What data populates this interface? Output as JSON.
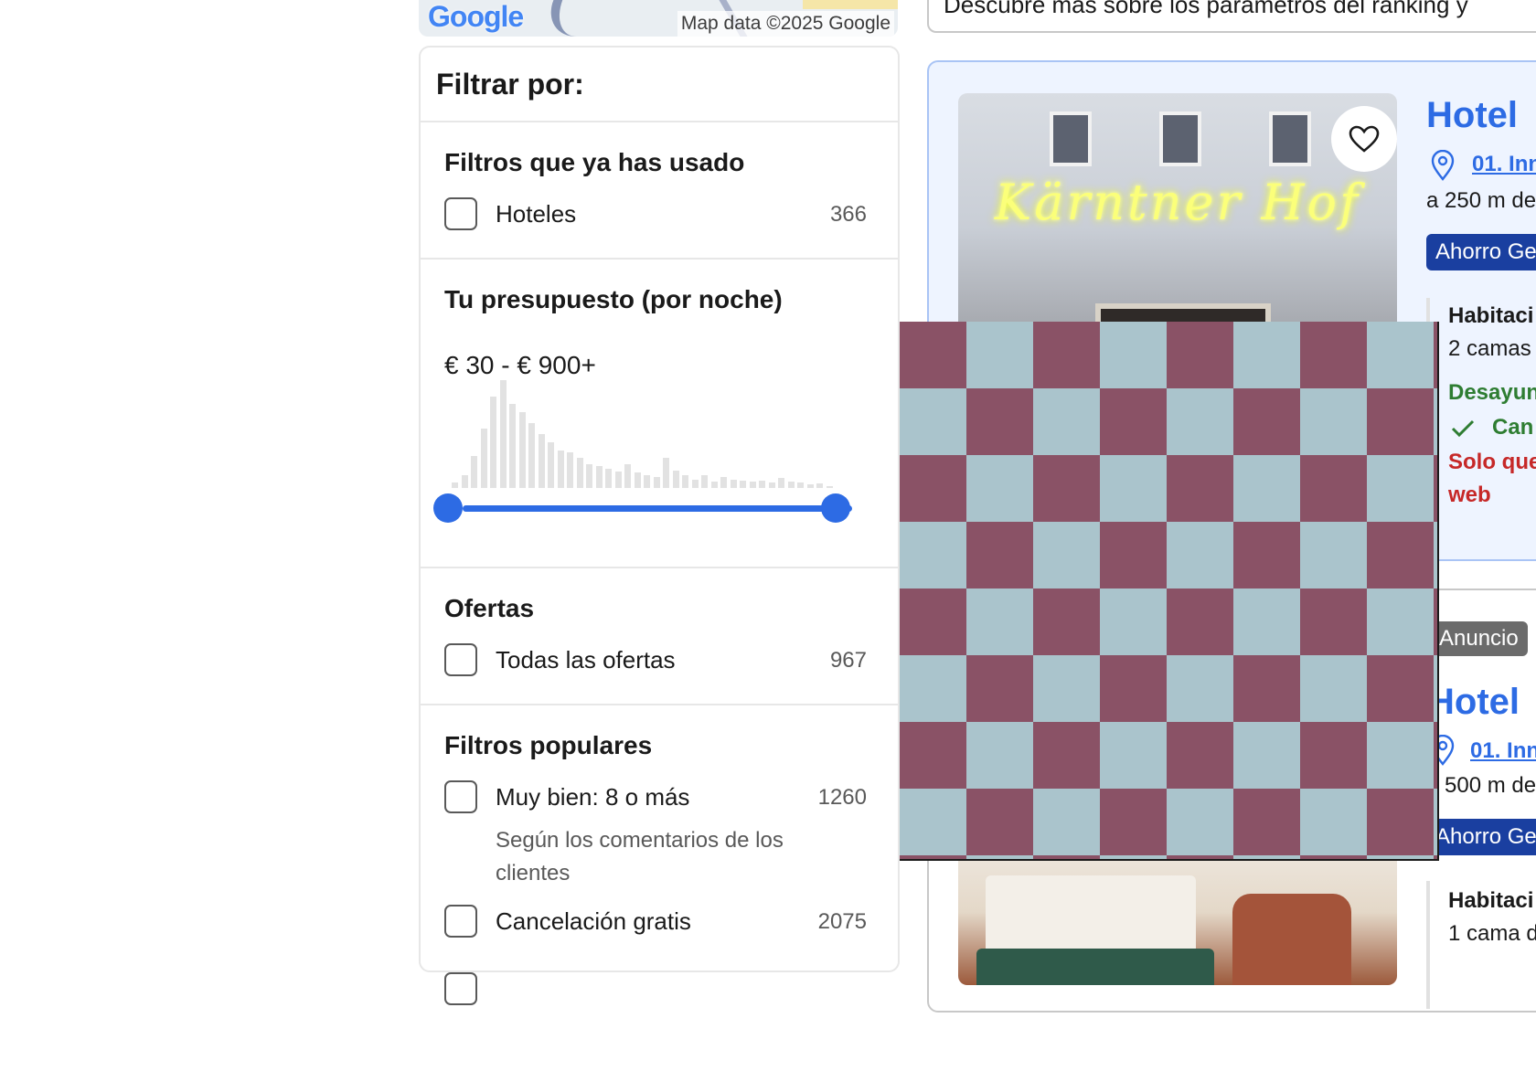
{
  "map": {
    "logo_text": "Google",
    "attribution": "Map data ©2025 Google"
  },
  "filters": {
    "title": "Filtrar por:",
    "used": {
      "heading": "Filtros que ya has usado",
      "items": [
        {
          "label": "Hoteles",
          "count": "366"
        }
      ]
    },
    "budget": {
      "heading": "Tu presupuesto (por noche)",
      "range_text": "€ 30 - € 900+",
      "range_min_fraction": 0.0,
      "range_max_fraction": 1.0,
      "histogram": [
        0.05,
        0.12,
        0.3,
        0.55,
        0.85,
        1.0,
        0.78,
        0.7,
        0.6,
        0.5,
        0.42,
        0.35,
        0.33,
        0.28,
        0.22,
        0.2,
        0.18,
        0.15,
        0.22,
        0.14,
        0.12,
        0.1,
        0.28,
        0.16,
        0.12,
        0.08,
        0.12,
        0.06,
        0.1,
        0.08,
        0.07,
        0.06,
        0.07,
        0.05,
        0.09,
        0.06,
        0.05,
        0.03,
        0.04,
        0.02
      ]
    },
    "offers": {
      "heading": "Ofertas",
      "items": [
        {
          "label": "Todas las ofertas",
          "count": "967"
        }
      ]
    },
    "popular": {
      "heading": "Filtros populares",
      "items": [
        {
          "label": "Muy bien: 8 o más",
          "count": "1260",
          "sub": "Según los comentarios de los clientes"
        },
        {
          "label": "Cancelación gratis",
          "count": "2075"
        }
      ]
    }
  },
  "results": {
    "info_banner": "Descubre más sobre los parámetros del ranking y",
    "cards": [
      {
        "name": "Hotel",
        "photo_sign": "Kärntner Hof",
        "location_link": "01. Inn",
        "distance": "a 250 m de",
        "badge": "Ahorro Ge",
        "room_title": "Habitaci",
        "room_beds": "2 camas",
        "breakfast": "Desayun",
        "cancel": "Can",
        "scarcity": "Solo que web"
      },
      {
        "ad_label": "Anuncio",
        "name": "Hotel",
        "location_link": "01. Inn",
        "distance": "500 m de",
        "badge": "Ahorro Ge",
        "room_title": "Habitaci",
        "room_beds": "1 cama d"
      }
    ]
  },
  "colors": {
    "accent": "#2d6be4",
    "badge": "#1a3fa0",
    "green": "#2e7d32",
    "red": "#c62828",
    "checker_a": "#aac4cc",
    "checker_b": "#8a5266"
  }
}
